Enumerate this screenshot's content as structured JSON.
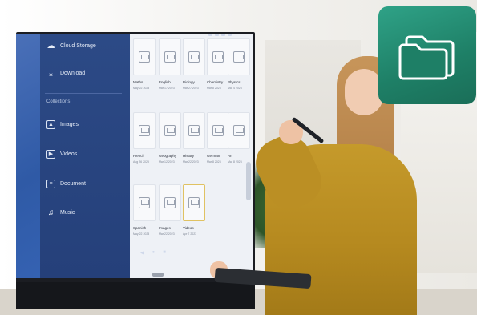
{
  "sidebar": {
    "items": [
      {
        "label": "Cloud Storage",
        "icon": "cloud-icon"
      },
      {
        "label": "Download",
        "icon": "download-icon"
      }
    ],
    "section_label": "Collections",
    "collections": [
      {
        "label": "Images",
        "icon": "image-icon"
      },
      {
        "label": "Videos",
        "icon": "video-icon"
      },
      {
        "label": "Document",
        "icon": "document-icon"
      },
      {
        "label": "Music",
        "icon": "music-icon"
      }
    ]
  },
  "folders": [
    {
      "name": "Maths",
      "date": "May 22 2023"
    },
    {
      "name": "English",
      "date": "Mar 17 2023"
    },
    {
      "name": "Biology",
      "date": "Mar 27 2023"
    },
    {
      "name": "Chemistry",
      "date": "Mar 8 2023"
    },
    {
      "name": "Physics",
      "date": "Mar 4 2023"
    },
    {
      "name": "French",
      "date": "Aug 26 2023"
    },
    {
      "name": "Geography",
      "date": "Mar 12 2023"
    },
    {
      "name": "History",
      "date": "Mar 22 2023"
    },
    {
      "name": "German",
      "date": "Mar 8 2023"
    },
    {
      "name": "Art",
      "date": "Mar 8 2023"
    },
    {
      "name": "Spanish",
      "date": "May 22 2023"
    },
    {
      "name": "Images",
      "date": "Mar 22 2023"
    },
    {
      "name": "Videos",
      "date": "Apr 7 2023"
    }
  ],
  "selected_folder": "Videos",
  "colors": {
    "badge": "#1e7f66",
    "sidebar": "#2c4a86",
    "sweater": "#b5891f"
  },
  "badge_icon": "folder-icon"
}
